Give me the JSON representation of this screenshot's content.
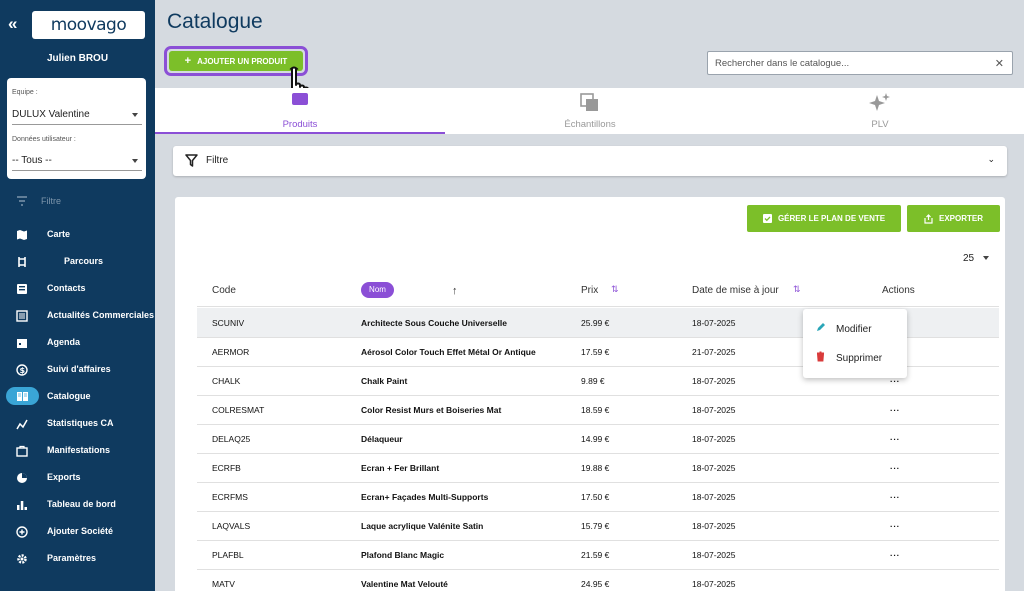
{
  "app": {
    "collapse_glyph": "«",
    "logo": "moovago",
    "user_name": "Julien BROU",
    "team_label": "Equipe :",
    "team_value": "DULUX Valentine",
    "userdata_label": "Données utilisateur :",
    "userdata_value": "-- Tous --",
    "filter_label": "Filtre"
  },
  "sidebar": {
    "items": [
      {
        "label": "Carte",
        "icon": "map-icon"
      },
      {
        "label": "Parcours",
        "icon": "route-icon"
      },
      {
        "label": "Contacts",
        "icon": "contacts-icon"
      },
      {
        "label": "Actualités Commerciales",
        "icon": "news-icon"
      },
      {
        "label": "Agenda",
        "icon": "calendar-icon"
      },
      {
        "label": "Suivi d'affaires",
        "icon": "deals-icon"
      },
      {
        "label": "Catalogue",
        "icon": "catalog-icon"
      },
      {
        "label": "Statistiques CA",
        "icon": "stats-icon"
      },
      {
        "label": "Manifestations",
        "icon": "briefcase-icon"
      },
      {
        "label": "Exports",
        "icon": "pie-icon"
      },
      {
        "label": "Tableau de bord",
        "icon": "bar-chart-icon"
      },
      {
        "label": "Ajouter Société",
        "icon": "add-circle-icon"
      },
      {
        "label": "Paramètres",
        "icon": "gear-icon"
      }
    ],
    "active": "Catalogue"
  },
  "main": {
    "title": "Catalogue",
    "add_button": "AJOUTER UN PRODUIT",
    "search_placeholder": "Rechercher dans le catalogue...",
    "tabs": [
      {
        "label": "Produits"
      },
      {
        "label": "Échantillons"
      },
      {
        "label": "PLV"
      }
    ],
    "filter": "Filtre",
    "plan_button": "GÉRER LE PLAN DE VENTE",
    "export_button": "EXPORTER",
    "per_page": "25"
  },
  "table": {
    "headers": {
      "code": "Code",
      "nom": "Nom",
      "prix": "Prix",
      "date": "Date de mise à jour",
      "actions": "Actions"
    },
    "rows": [
      {
        "code": "SCUNIV",
        "nom": "Architecte Sous Couche Universelle",
        "prix": "25.99 €",
        "date": "18-07-2025"
      },
      {
        "code": "AERMOR",
        "nom": "Aérosol Color Touch Effet Métal Or Antique",
        "prix": "17.59 €",
        "date": "21-07-2025"
      },
      {
        "code": "CHALK",
        "nom": "Chalk Paint",
        "prix": "9.89 €",
        "date": "18-07-2025"
      },
      {
        "code": "COLRESMAT",
        "nom": "Color Resist Murs et Boiseries Mat",
        "prix": "18.59 €",
        "date": "18-07-2025"
      },
      {
        "code": "DELAQ25",
        "nom": "Délaqueur",
        "prix": "14.99 €",
        "date": "18-07-2025"
      },
      {
        "code": "ECRFB",
        "nom": "Ecran + Fer Brillant",
        "prix": "19.88 €",
        "date": "18-07-2025"
      },
      {
        "code": "ECRFMS",
        "nom": "Ecran+ Façades Multi-Supports",
        "prix": "17.50 €",
        "date": "18-07-2025"
      },
      {
        "code": "LAQVALS",
        "nom": "Laque acrylique Valénite Satin",
        "prix": "15.79 €",
        "date": "18-07-2025"
      },
      {
        "code": "PLAFBL",
        "nom": "Plafond Blanc Magic",
        "prix": "21.59 €",
        "date": "18-07-2025"
      },
      {
        "code": "MATV",
        "nom": "Valentine Mat Velouté",
        "prix": "24.95 €",
        "date": "18-07-2025"
      }
    ],
    "action_glyph": "···"
  },
  "context_menu": {
    "edit": "Modifier",
    "delete": "Supprimer"
  },
  "colors": {
    "sidebar": "#0f3a5f",
    "accent_green": "#7cbf29",
    "accent_purple": "#8b4fd6",
    "active_nav": "#3aa5d6"
  }
}
